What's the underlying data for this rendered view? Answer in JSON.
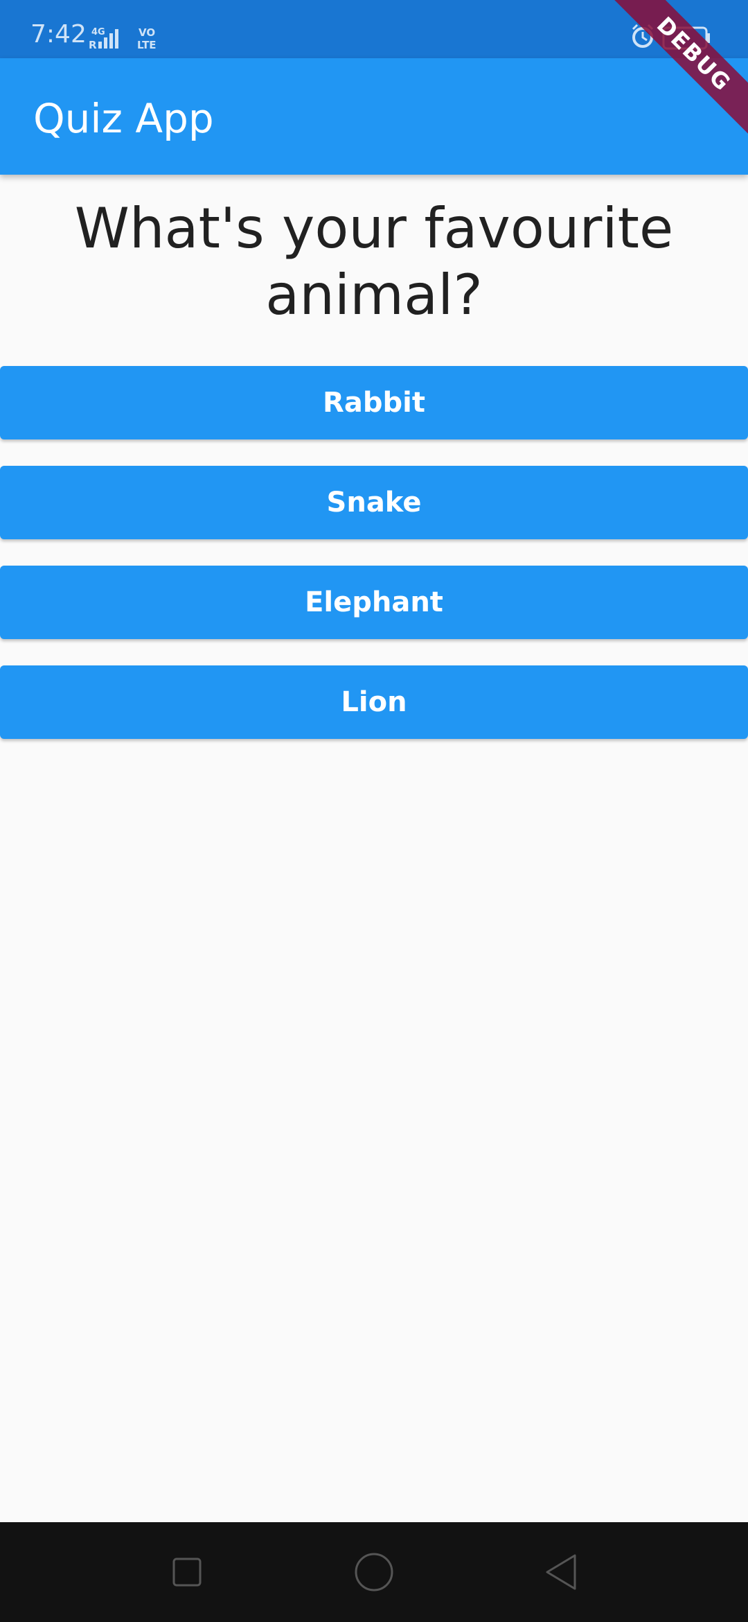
{
  "status_bar": {
    "time": "7:42",
    "network_4g": "4G",
    "network_r": "R",
    "volte_top": "VO",
    "volte_bottom": "LTE",
    "icons": [
      "signal-icon",
      "alarm-icon",
      "battery-icon"
    ]
  },
  "app_bar": {
    "title": "Quiz App"
  },
  "debug_banner": {
    "label": "DEBUG"
  },
  "question": {
    "text": "What's your favourite animal?"
  },
  "answers": [
    {
      "label": "Rabbit"
    },
    {
      "label": "Snake"
    },
    {
      "label": "Elephant"
    },
    {
      "label": "Lion"
    }
  ],
  "navigation": {
    "icons": [
      "recents-square-icon",
      "home-circle-icon",
      "back-triangle-icon"
    ]
  },
  "colors": {
    "status_bar": "#1976d2",
    "app_bar": "#2196f3",
    "button": "#2196f3",
    "background": "#fafafa",
    "nav_bar": "#121212",
    "debug_ribbon": "#880e39"
  }
}
